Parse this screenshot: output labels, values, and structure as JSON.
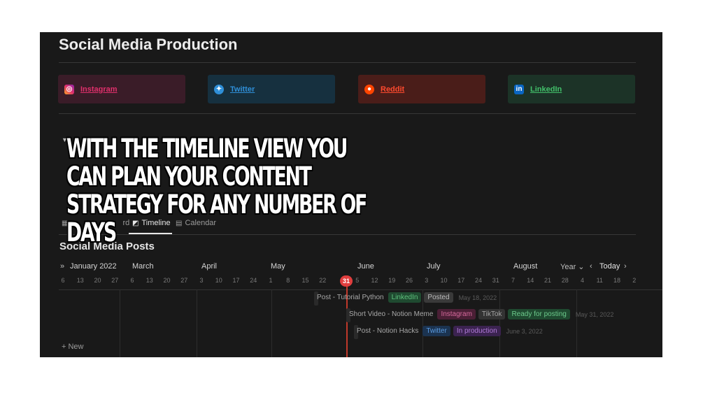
{
  "page": {
    "title": "Social Media Production"
  },
  "links": [
    {
      "label": "Instagram",
      "color": "#e1306c",
      "bg": "#3a1c28",
      "icon": "instagram-icon"
    },
    {
      "label": "Twitter",
      "color": "#2f8fd8",
      "bg": "#16303f",
      "icon": "twitter-icon"
    },
    {
      "label": "Reddit",
      "color": "#ff4a2e",
      "bg": "#4a1d19",
      "icon": "reddit-icon"
    },
    {
      "label": "LinkedIn",
      "color": "#42c06a",
      "bg": "#1c3327",
      "icon": "linkedin-icon"
    }
  ],
  "overlay": {
    "text": "WITH THE TIMELINE VIEW YOU\nCAN PLAN YOUR CONTENT\nSTRATEGY FOR ANY NUMBER OF\nDAYS"
  },
  "views": {
    "board": "rd",
    "timeline": "Timeline",
    "calendar": "Calendar"
  },
  "database": {
    "title": "Social Media Posts"
  },
  "timeline": {
    "months": [
      "January 2022",
      "March",
      "April",
      "May",
      "June",
      "July",
      "August"
    ],
    "ticks": [
      "6",
      "13",
      "20",
      "27",
      "6",
      "13",
      "20",
      "27",
      "3",
      "10",
      "17",
      "24",
      "1",
      "8",
      "15",
      "22",
      "31",
      "5",
      "12",
      "19",
      "26",
      "3",
      "10",
      "17",
      "24",
      "31",
      "7",
      "14",
      "21",
      "28",
      "4",
      "11",
      "18",
      "2"
    ],
    "today_day": "31",
    "scale": "Year",
    "today_label": "Today",
    "new_label": "New",
    "items": [
      {
        "name": "Post - Tutorial Python",
        "tags": [
          {
            "text": "LinkedIn",
            "bg": "#1f4a30",
            "fg": "#5fc47e"
          },
          {
            "text": "Posted",
            "bg": "#3a3a3a",
            "fg": "#bcbcbc"
          }
        ],
        "date": "May 18, 2022"
      },
      {
        "name": "Short Video - Notion Meme",
        "tags": [
          {
            "text": "Instagram",
            "bg": "#4a1f35",
            "fg": "#d66a9c"
          },
          {
            "text": "TikTok",
            "bg": "#333333",
            "fg": "#a5a5a5"
          },
          {
            "text": "Ready for posting",
            "bg": "#1f4a30",
            "fg": "#6cc98b"
          }
        ],
        "date": "May 31, 2022"
      },
      {
        "name": "Post - Notion Hacks",
        "tags": [
          {
            "text": "Twitter",
            "bg": "#1b3350",
            "fg": "#5b9be0"
          },
          {
            "text": "In production",
            "bg": "#3b2350",
            "fg": "#b07ad8"
          }
        ],
        "date": "June 3, 2022"
      }
    ]
  }
}
